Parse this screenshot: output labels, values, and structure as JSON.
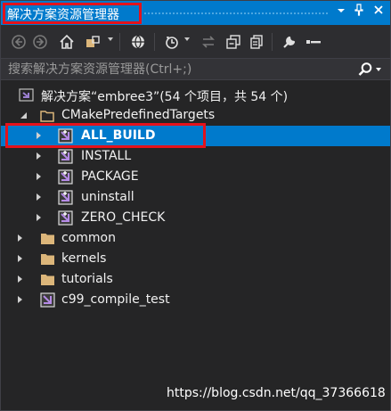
{
  "window": {
    "title": "解决方案资源管理器",
    "pin_glyph": "▾",
    "autohide_glyph": "⊥",
    "close_glyph": "✕"
  },
  "toolbar": {
    "icons": [
      "back-icon",
      "forward-icon",
      "home-icon",
      "switch-views-icon",
      "globe-icon",
      "pending-changes-icon",
      "sync-icon",
      "collapse-all-icon",
      "show-all-files-icon",
      "properties-icon",
      "preview-icon"
    ]
  },
  "search": {
    "placeholder": "搜索解决方案资源管理器(Ctrl+;)"
  },
  "tree": {
    "solution": {
      "label": "解决方案“embree3”(54 个项目，共 54 个)",
      "icon": "solution-icon"
    },
    "folders": [
      {
        "label": "CMakePredefinedTargets",
        "expanded": true,
        "children": [
          {
            "label": "ALL_BUILD",
            "selected": true
          },
          {
            "label": "INSTALL"
          },
          {
            "label": "PACKAGE"
          },
          {
            "label": "uninstall"
          },
          {
            "label": "ZERO_CHECK"
          }
        ]
      },
      {
        "label": "common",
        "expanded": false
      },
      {
        "label": "kernels",
        "expanded": false
      },
      {
        "label": "tutorials",
        "expanded": false
      }
    ],
    "projects": [
      {
        "label": "c99_compile_test"
      }
    ]
  },
  "watermark": "https://blog.csdn.net/qq_37366618",
  "colors": {
    "accent": "#007acc",
    "highlight_box": "#e5121b",
    "background": "#252526",
    "folder": "#dcb67a",
    "project": "#9b7fd1"
  }
}
